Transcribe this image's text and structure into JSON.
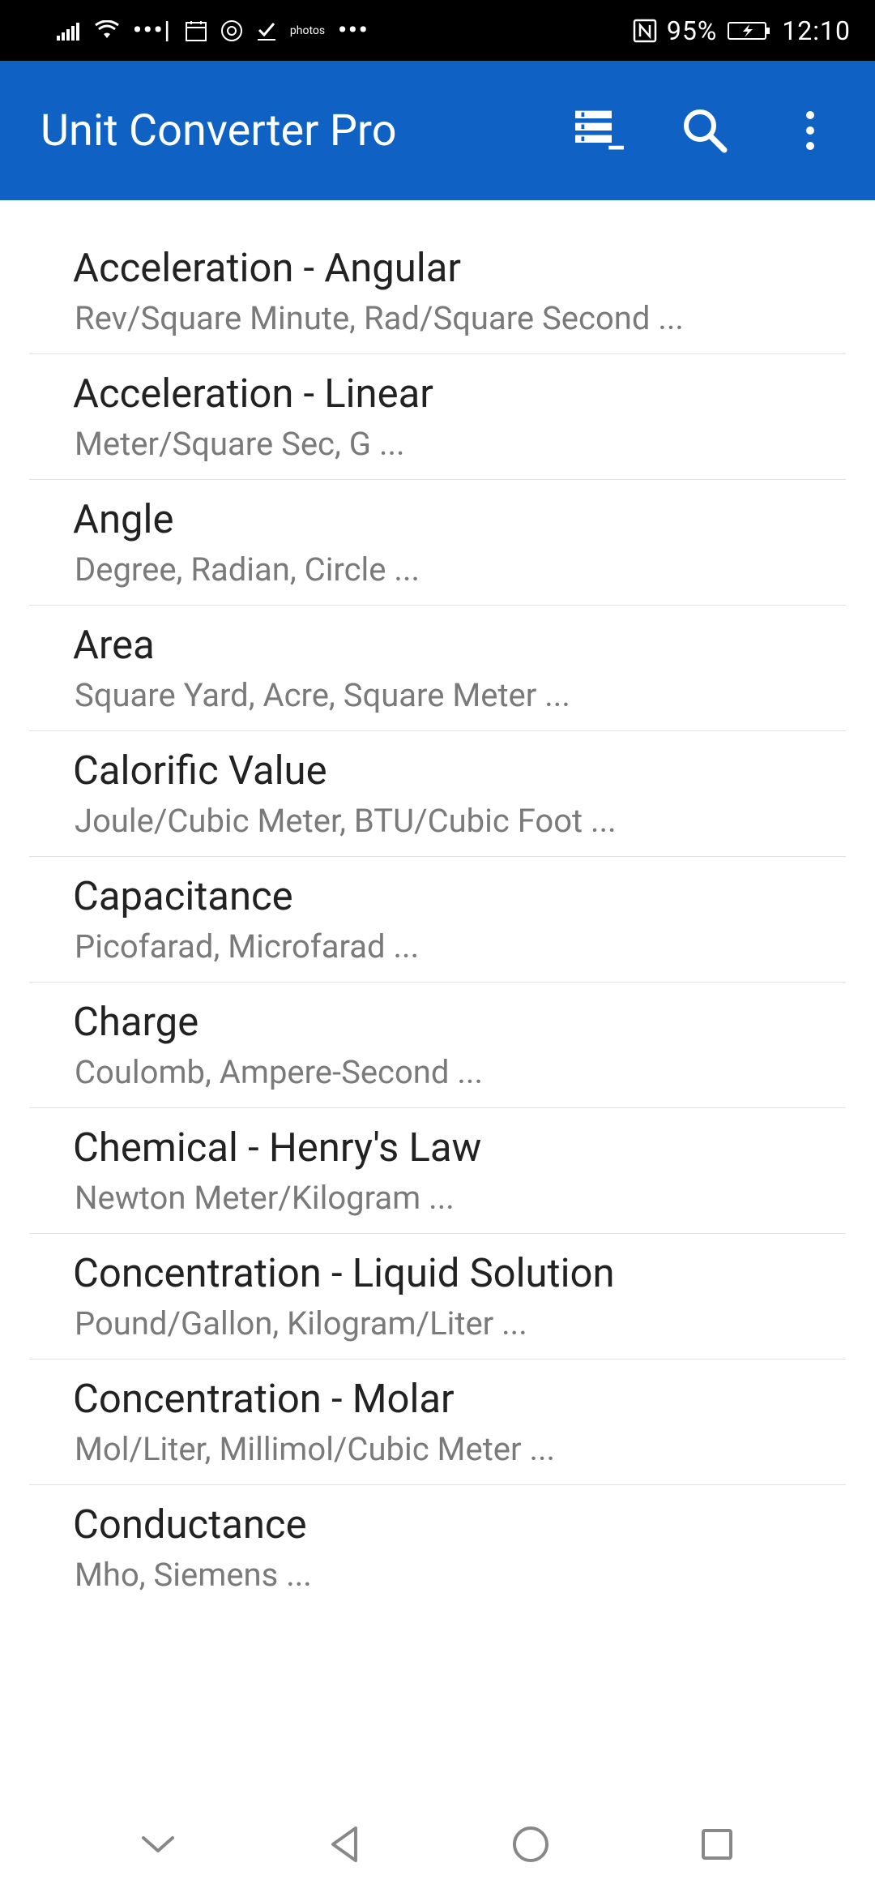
{
  "status_bar": {
    "battery_percent": "95%",
    "time": "12:10"
  },
  "app_bar": {
    "title": "Unit Converter Pro"
  },
  "categories": [
    {
      "title": "Acceleration - Angular",
      "sub": "Rev/Square Minute, Rad/Square Second ..."
    },
    {
      "title": "Acceleration - Linear",
      "sub": "Meter/Square Sec, G ..."
    },
    {
      "title": "Angle",
      "sub": "Degree, Radian, Circle ..."
    },
    {
      "title": "Area",
      "sub": "Square Yard, Acre, Square Meter ..."
    },
    {
      "title": "Calorific Value",
      "sub": "Joule/Cubic Meter, BTU/Cubic Foot ..."
    },
    {
      "title": "Capacitance",
      "sub": "Picofarad, Microfarad ..."
    },
    {
      "title": "Charge",
      "sub": "Coulomb, Ampere-Second ..."
    },
    {
      "title": "Chemical - Henry's Law",
      "sub": "Newton Meter/Kilogram ..."
    },
    {
      "title": "Concentration - Liquid Solution",
      "sub": "Pound/Gallon, Kilogram/Liter ..."
    },
    {
      "title": "Concentration - Molar",
      "sub": "Mol/Liter, Millimol/Cubic Meter ..."
    },
    {
      "title": "Conductance",
      "sub": "Mho, Siemens ..."
    }
  ]
}
